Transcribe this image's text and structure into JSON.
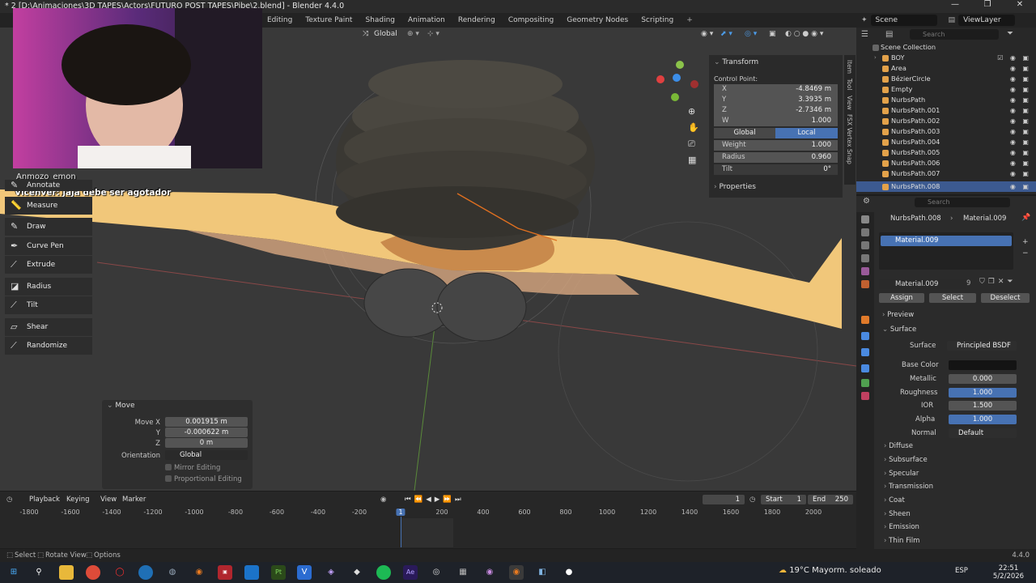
{
  "window": {
    "title": "* 2 [D:\\Animaciones\\3D TAPES\\Actors\\FUTURO POST TAPES\\Pibe\\2.blend] - Blender 4.4.0",
    "controls": [
      "—",
      "❐",
      "✕"
    ]
  },
  "workspaces": [
    "Editing",
    "Texture Paint",
    "Shading",
    "Animation",
    "Rendering",
    "Compositing",
    "Geometry Nodes",
    "Scripting",
    "+"
  ],
  "scene": {
    "label": "Scene",
    "view_layer": "ViewLayer"
  },
  "viewport": {
    "orientation": "Global",
    "overlay_colors": {
      "ribbon": "#f1c77a",
      "hair": "#3a3833",
      "face": "#c98a4c",
      "background": "#393939"
    }
  },
  "chat": {
    "user": "Anmozo_emon",
    "message": "Vicenver: jaja debe ser agotador"
  },
  "tools": [
    {
      "label": "Annotate",
      "icon": "pencil-icon"
    },
    {
      "label": "Measure",
      "icon": "ruler-icon"
    },
    {
      "label": "Draw",
      "icon": "draw-icon"
    },
    {
      "label": "Curve Pen",
      "icon": "pen-icon"
    },
    {
      "label": "Extrude",
      "icon": "extrude-icon"
    },
    {
      "label": "Radius",
      "icon": "radius-icon"
    },
    {
      "label": "Tilt",
      "icon": "tilt-icon"
    },
    {
      "label": "Shear",
      "icon": "shear-icon"
    },
    {
      "label": "Randomize",
      "icon": "randomize-icon"
    }
  ],
  "move_panel": {
    "title": "Move",
    "move_x_label": "Move X",
    "move_x": "0.001915 m",
    "y_label": "Y",
    "y": "-0.000622 m",
    "z_label": "Z",
    "z": "0 m",
    "orientation_label": "Orientation",
    "orientation": "Global",
    "mirror": "Mirror Editing",
    "proportional": "Proportional Editing"
  },
  "transform": {
    "title": "Transform",
    "control_point": "Control Point:",
    "x_label": "X",
    "x": "-4.8469 m",
    "y_label": "Y",
    "y": "3.3935 m",
    "z_label": "Z",
    "z": "-2.7346 m",
    "w_label": "W",
    "w": "1.000",
    "global": "Global",
    "local": "Local",
    "weight_label": "Weight",
    "weight": "1.000",
    "radius_label": "Radius",
    "radius": "0.960",
    "tilt_label": "Tilt",
    "tilt": "0°",
    "properties": "Properties",
    "side_tabs": [
      "Item",
      "Tool",
      "View",
      "FSX Vertex Snap"
    ]
  },
  "outliner": {
    "search_placeholder": "Search",
    "collection": "Scene Collection",
    "items": [
      {
        "name": "BOY",
        "color": "#e3a24a"
      },
      {
        "name": "Area",
        "color": "#e3a24a"
      },
      {
        "name": "BézierCircle",
        "color": "#e3a24a"
      },
      {
        "name": "Empty",
        "color": "#e3a24a"
      },
      {
        "name": "NurbsPath",
        "color": "#e3a24a"
      },
      {
        "name": "NurbsPath.001",
        "color": "#e3a24a"
      },
      {
        "name": "NurbsPath.002",
        "color": "#e3a24a"
      },
      {
        "name": "NurbsPath.003",
        "color": "#e3a24a"
      },
      {
        "name": "NurbsPath.004",
        "color": "#e3a24a"
      },
      {
        "name": "NurbsPath.005",
        "color": "#e3a24a"
      },
      {
        "name": "NurbsPath.006",
        "color": "#e3a24a"
      },
      {
        "name": "NurbsPath.007",
        "color": "#e3a24a"
      },
      {
        "name": "NurbsPath.008",
        "color": "#e3a24a"
      }
    ]
  },
  "properties": {
    "search_placeholder": "Search",
    "breadcrumb_object": "NurbsPath.008",
    "breadcrumb_material": "Material.009",
    "slot": "Material.009",
    "material_name": "Material.009",
    "users": "9",
    "assign": "Assign",
    "select": "Select",
    "deselect": "Deselect",
    "preview": "Preview",
    "surface_section": "Surface",
    "surface_label": "Surface",
    "surface": "Principled BSDF",
    "base_color_label": "Base Color",
    "metallic_label": "Metallic",
    "metallic": "0.000",
    "roughness_label": "Roughness",
    "roughness": "1.000",
    "ior_label": "IOR",
    "ior": "1.500",
    "alpha_label": "Alpha",
    "alpha": "1.000",
    "normal_label": "Normal",
    "normal": "Default",
    "sections": [
      "Diffuse",
      "Subsurface",
      "Specular",
      "Transmission",
      "Coat",
      "Sheen",
      "Emission",
      "Thin Film"
    ]
  },
  "timeline": {
    "menus": [
      "Playback",
      "Keying",
      "View",
      "Marker"
    ],
    "current_frame": "1",
    "start_label": "Start",
    "start": "1",
    "end_label": "End",
    "end": "250",
    "ticks": [
      "-1800",
      "-1600",
      "-1400",
      "-1200",
      "-1000",
      "-800",
      "-600",
      "-400",
      "-200",
      "1",
      "200",
      "400",
      "600",
      "800",
      "1000",
      "1200",
      "1400",
      "1600",
      "1800",
      "2000"
    ]
  },
  "status": {
    "select": "Select",
    "rotate": "Rotate View",
    "options": "Options",
    "version": "4.4.0"
  },
  "taskbar": {
    "weather": "19°C  Mayorm. soleado",
    "lang": "ESP",
    "time": "22:51",
    "date": "5/2/2026"
  }
}
